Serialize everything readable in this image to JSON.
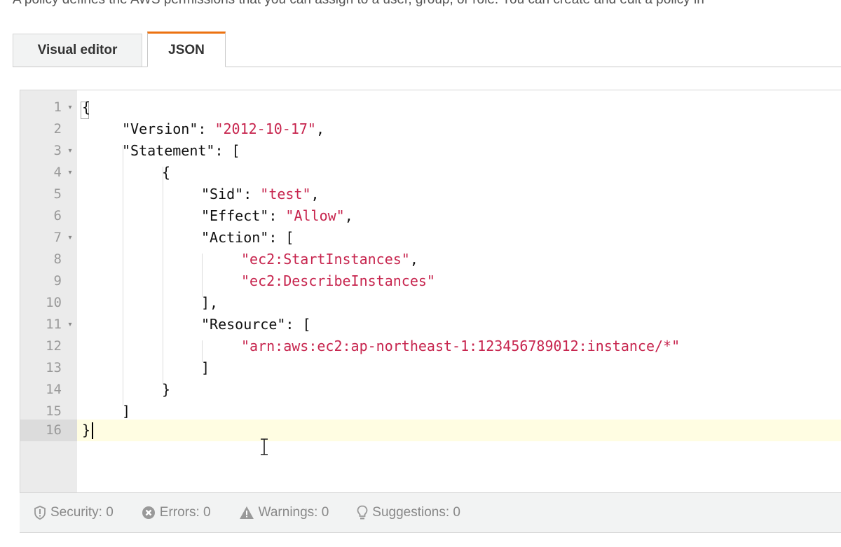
{
  "intro_text": "A policy defines the AWS permissions that you can assign to a user, group, or role. You can create and edit a policy in",
  "tabs": [
    {
      "label": "Visual editor",
      "active": false
    },
    {
      "label": "JSON",
      "active": true
    }
  ],
  "editor": {
    "lines": [
      {
        "n": "1",
        "fold": true
      },
      {
        "n": "2",
        "fold": false
      },
      {
        "n": "3",
        "fold": true
      },
      {
        "n": "4",
        "fold": true
      },
      {
        "n": "5",
        "fold": false
      },
      {
        "n": "6",
        "fold": false
      },
      {
        "n": "7",
        "fold": true
      },
      {
        "n": "8",
        "fold": false
      },
      {
        "n": "9",
        "fold": false
      },
      {
        "n": "10",
        "fold": false
      },
      {
        "n": "11",
        "fold": true
      },
      {
        "n": "12",
        "fold": false
      },
      {
        "n": "13",
        "fold": false
      },
      {
        "n": "14",
        "fold": false
      },
      {
        "n": "15",
        "fold": false
      },
      {
        "n": "16",
        "fold": false
      }
    ],
    "code": {
      "l1": "{",
      "l2_key": "\"Version\": ",
      "l2_val": "\"2012-10-17\"",
      "l2_tail": ",",
      "l3": "\"Statement\": [",
      "l4": "{",
      "l5_key": "\"Sid\": ",
      "l5_val": "\"test\"",
      "l5_tail": ",",
      "l6_key": "\"Effect\": ",
      "l6_val": "\"Allow\"",
      "l6_tail": ",",
      "l7": "\"Action\": [",
      "l8_val": "\"ec2:StartInstances\"",
      "l8_tail": ",",
      "l9_val": "\"ec2:DescribeInstances\"",
      "l10": "],",
      "l11": "\"Resource\": [",
      "l12_val": "\"arn:aws:ec2:ap-northeast-1:123456789012:instance/*\"",
      "l13": "]",
      "l14": "}",
      "l15": "]",
      "l16": "}"
    },
    "current_line": "16",
    "fold_glyph": "▾",
    "colors": {
      "string": "#c7254e",
      "active_tab_accent": "#ec7211",
      "current_line_bg": "#fffde2"
    }
  },
  "status": {
    "security": "Security: 0",
    "errors": "Errors: 0",
    "warnings": "Warnings: 0",
    "suggestions": "Suggestions: 0"
  }
}
